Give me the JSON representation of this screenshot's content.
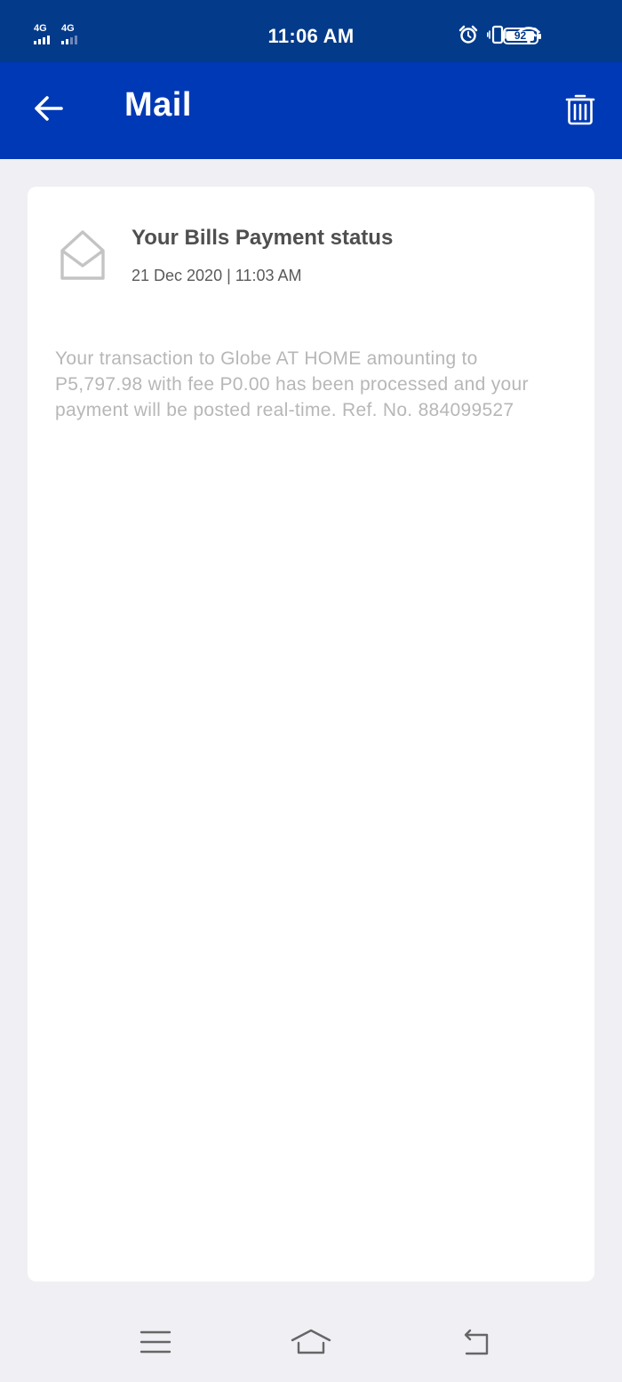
{
  "status_bar": {
    "network_1": "4G",
    "network_2": "4G",
    "time": "11:06 AM",
    "battery_level": "92",
    "icons": [
      "alarm-icon",
      "vibrate-icon",
      "wifi-icon",
      "battery-icon"
    ]
  },
  "header": {
    "title": "Mail",
    "back_icon": "arrow-left-icon",
    "delete_icon": "trash-icon"
  },
  "mail": {
    "icon": "envelope-open-icon",
    "subject": "Your Bills Payment status",
    "date": "21 Dec 2020 | 11:03 AM",
    "body": "Your transaction to Globe AT HOME amounting to P5,797.98 with fee P0.00 has been processed and your payment will be posted real-time. Ref. No. 884099527"
  },
  "nav_bar": {
    "icons": [
      "menu-icon",
      "home-icon",
      "back-icon"
    ]
  },
  "colors": {
    "status_bar": "#033a8a",
    "header": "#0039b5",
    "background": "#efeff4",
    "card": "#ffffff",
    "subject_text": "#4f4f4f",
    "body_text": "#b7b7b7"
  }
}
